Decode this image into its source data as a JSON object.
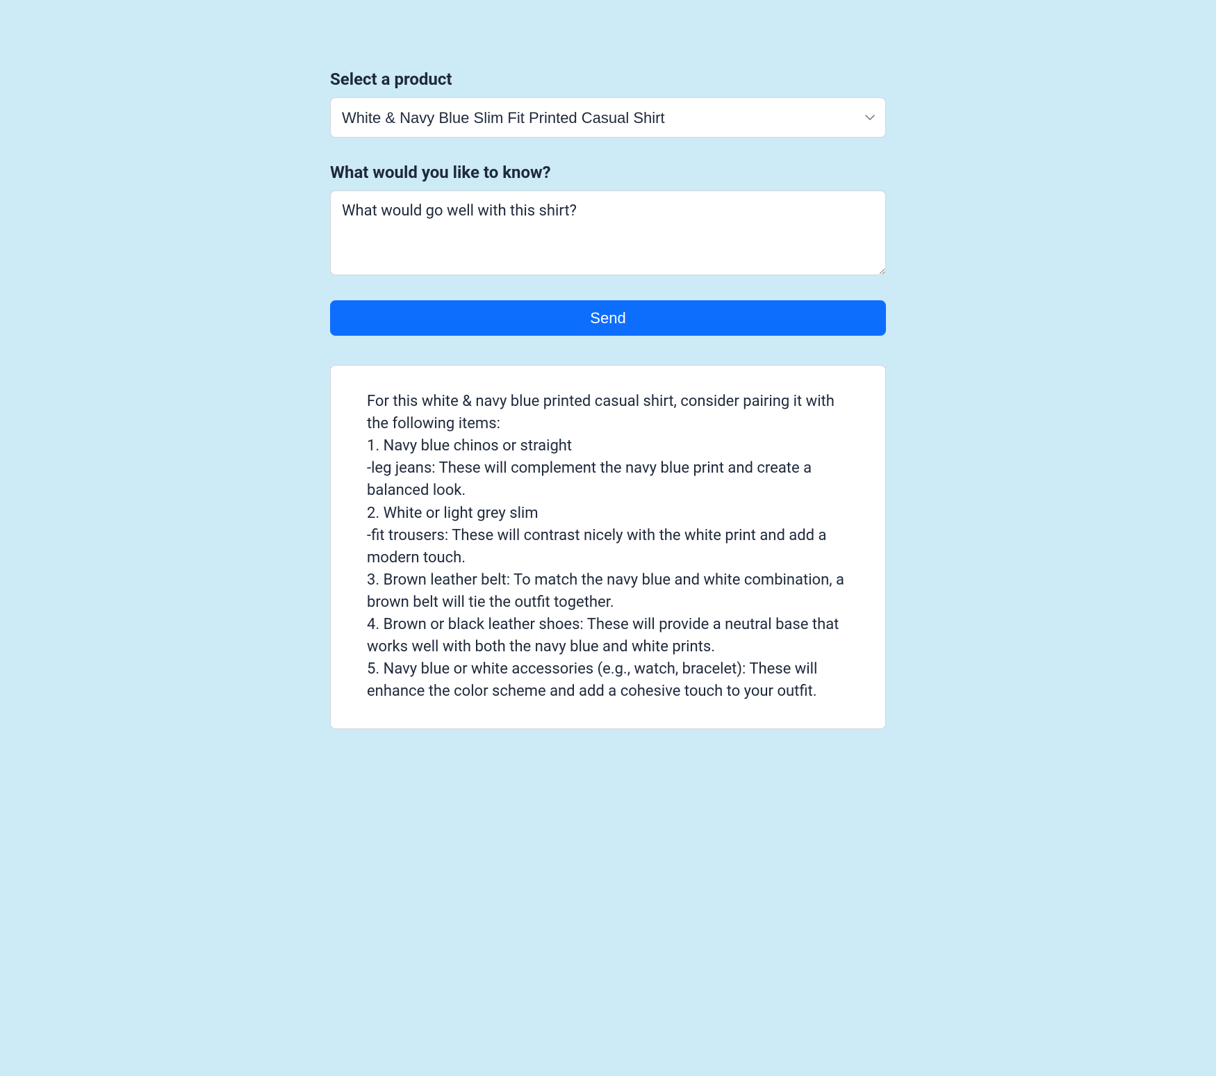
{
  "form": {
    "product_label": "Select a product",
    "product_selected": "White & Navy Blue Slim Fit Printed Casual Shirt",
    "question_label": "What would you like to know?",
    "question_value": "What would go well with this shirt?",
    "send_label": "Send"
  },
  "response": {
    "text": "For this white & navy blue printed casual shirt, consider pairing it with the following items:\n1. Navy blue chinos or straight\n-leg jeans: These will complement the navy blue print and create a balanced look.\n2. White or light grey slim\n-fit trousers: These will contrast nicely with the white print and add a modern touch.\n3. Brown leather belt: To match the navy blue and white combination, a brown belt will tie the outfit together.\n4. Brown or black leather shoes: These will provide a neutral base that works well with both the navy blue and white prints.\n5. Navy blue or white accessories (e.g., watch, bracelet): These will enhance the color scheme and add a cohesive touch to your outfit."
  }
}
